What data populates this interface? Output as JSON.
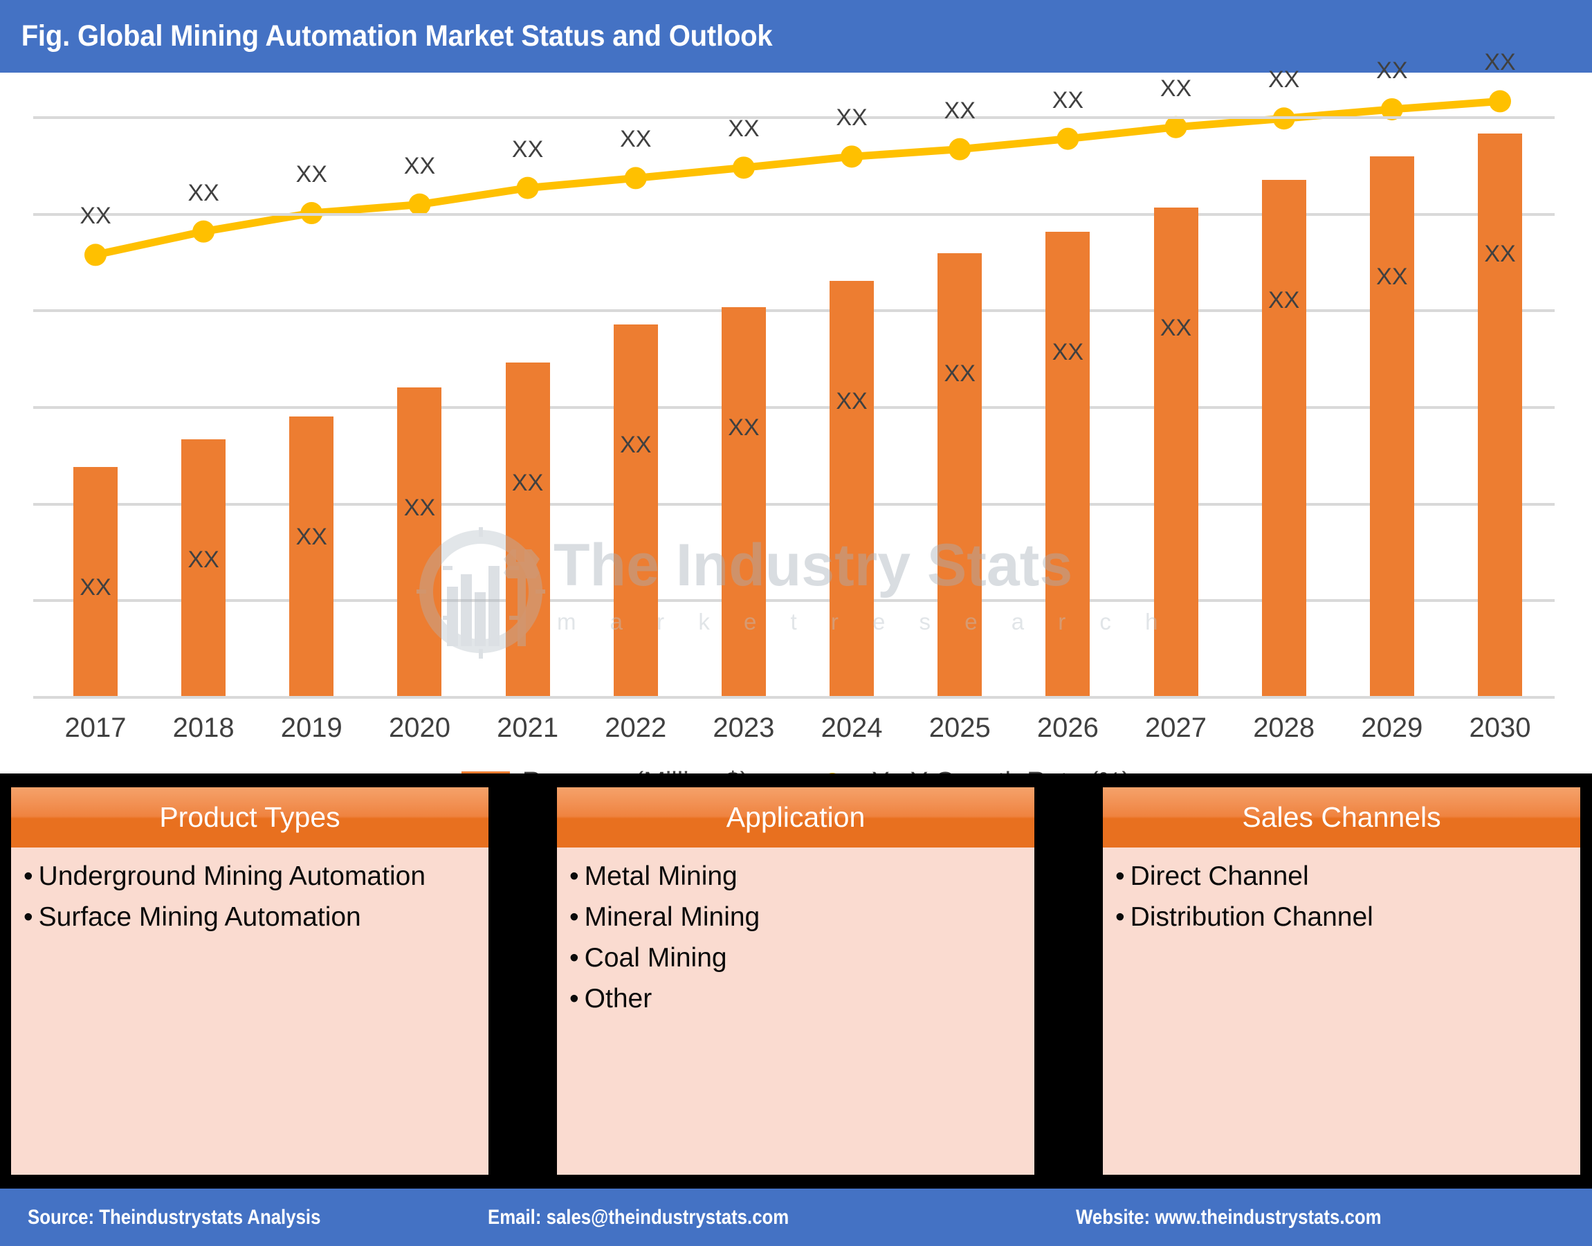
{
  "title": "Fig. Global Mining Automation Market Status and Outlook",
  "colors": {
    "title_bar": "#4472c4",
    "bar": "#ed7d31",
    "line": "#ffc000",
    "grid": "#d9d9d9",
    "panel_header": "#e8701f",
    "panel_body": "#fadbd0",
    "band": "#000000",
    "footer": "#4472c4"
  },
  "watermark": {
    "brand": "The Industry Stats",
    "tagline": "m a r k e t   r e s e a r c h",
    "logo": "gear-factory-wrench-icon"
  },
  "legend": {
    "items": [
      {
        "label": "Revenue (Million $)",
        "marker": "square-swatch",
        "color": "#ed7d31"
      },
      {
        "label": "Y-oY Growth Rate (%)",
        "marker": "line-with-dot",
        "color": "#ffc000"
      }
    ]
  },
  "segments": [
    {
      "header": "Product Types",
      "items": [
        "Underground Mining Automation",
        "Surface Mining Automation"
      ]
    },
    {
      "header": "Application",
      "items": [
        "Metal Mining",
        "Mineral Mining",
        "Coal Mining",
        "Other"
      ]
    },
    {
      "header": "Sales Channels",
      "items": [
        "Direct Channel",
        "Distribution Channel"
      ]
    }
  ],
  "footer": {
    "source": "Source: Theindustrystats Analysis",
    "email": "Email: sales@theindustrystats.com",
    "website": "Website: www.theindustrystats.com"
  },
  "chart_data": {
    "type": "bar",
    "title": "Fig. Global Mining Automation Market Status and Outlook",
    "xlabel": "",
    "ylabel": "",
    "grid": true,
    "gridlines": 6,
    "legend_position": "bottom",
    "categories": [
      "2017",
      "2018",
      "2019",
      "2020",
      "2021",
      "2022",
      "2023",
      "2024",
      "2025",
      "2026",
      "2027",
      "2028",
      "2029",
      "2030"
    ],
    "series": [
      {
        "name": "Revenue (Million $)",
        "type": "bar",
        "color": "#ed7d31",
        "value_labels": [
          "XX",
          "XX",
          "XX",
          "XX",
          "XX",
          "XX",
          "XX",
          "XX",
          "XX",
          "XX",
          "XX",
          "XX",
          "XX",
          "XX"
        ],
        "values_normalized": [
          0.373,
          0.418,
          0.455,
          0.502,
          0.543,
          0.605,
          0.633,
          0.676,
          0.721,
          0.756,
          0.795,
          0.84,
          0.878,
          0.915
        ]
      },
      {
        "name": "Y-oY Growth Rate (%)",
        "type": "line",
        "color": "#ffc000",
        "value_labels": [
          "XX",
          "XX",
          "XX",
          "XX",
          "XX",
          "XX",
          "XX",
          "XX",
          "XX",
          "XX",
          "XX",
          "XX",
          "XX",
          "XX"
        ],
        "values_normalized": [
          0.718,
          0.756,
          0.786,
          0.8,
          0.827,
          0.843,
          0.86,
          0.878,
          0.89,
          0.907,
          0.926,
          0.94,
          0.955,
          0.968
        ]
      }
    ]
  }
}
